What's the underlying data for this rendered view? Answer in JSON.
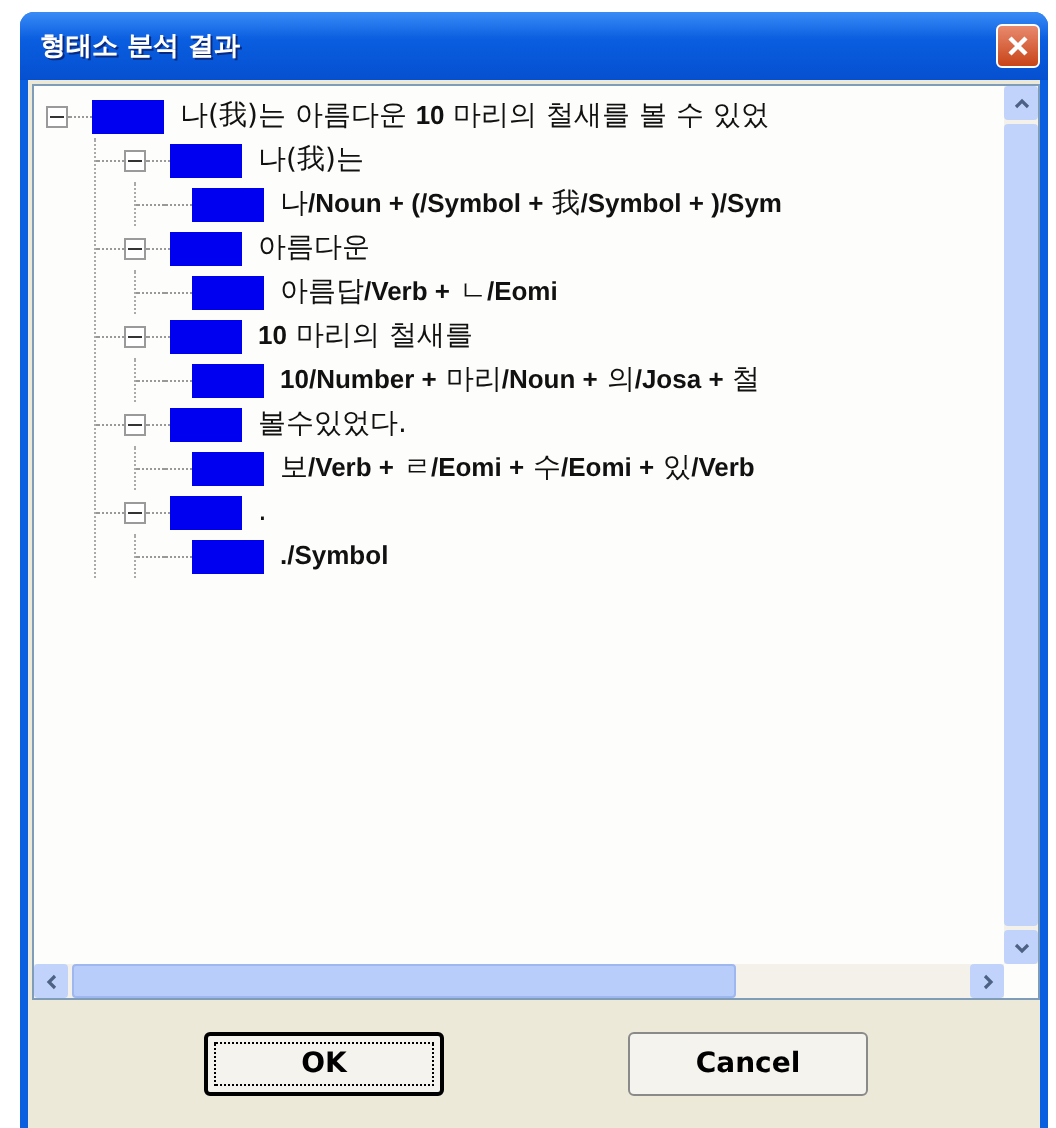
{
  "window": {
    "title": "형태소 분석 결과"
  },
  "tree": [
    {
      "label": "나(我)는 아름다운 **10** 마리의 철새를 볼 수 있었",
      "expanded": true,
      "children": [
        {
          "label": "나(我)는",
          "expanded": true,
          "children": [
            {
              "label": "나**/Noun + (/Symbol +** 我**/Symbol + )/Sym**"
            }
          ]
        },
        {
          "label": "아름다운",
          "expanded": true,
          "children": [
            {
              "label": "아름답**/Verb +** ㄴ**/Eomi**"
            }
          ]
        },
        {
          "label": "**10** 마리의 철새를",
          "expanded": true,
          "children": [
            {
              "label": "**10/Number +** 마리**/Noun +** 의**/Josa +** 철"
            }
          ]
        },
        {
          "label": "볼수있었다.",
          "expanded": true,
          "children": [
            {
              "label": "보**/Verb +** ㄹ**/Eomi +** 수**/Eomi +** 있**/Verb**"
            }
          ]
        },
        {
          "label": ".",
          "expanded": true,
          "children": [
            {
              "label": "**./Symbol**"
            }
          ]
        }
      ]
    }
  ],
  "buttons": [
    {
      "label": "OK",
      "selected": true
    },
    {
      "label": "Cancel",
      "selected": false
    }
  ]
}
